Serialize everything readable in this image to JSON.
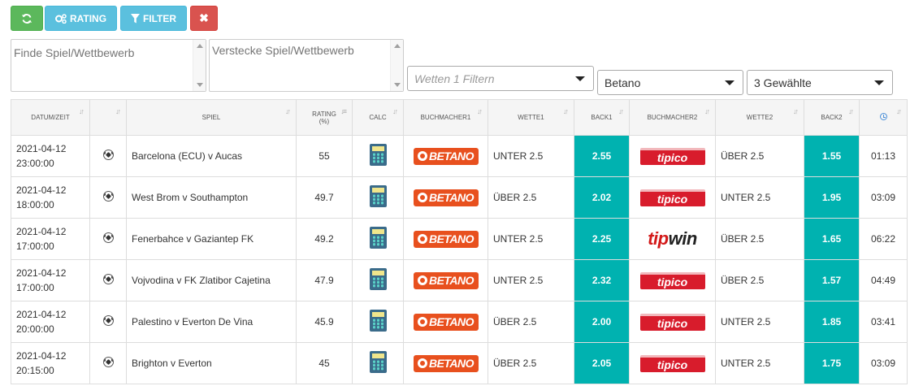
{
  "toolbar": {
    "refresh_icon": "refresh-icon",
    "rating_label": "RATING",
    "filter_label": "FILTER",
    "close_label": "✖"
  },
  "filters": {
    "find_placeholder": "Finde Spiel/Wettbewerb",
    "hide_placeholder": "Verstecke Spiel/Wettbewerb",
    "wetten_placeholder": "Wetten 1 Filtern",
    "bookmaker_selected": "Betano",
    "multi_selected": "3 Gewählte"
  },
  "table": {
    "headers": {
      "datum": "DATUM/ZEIT",
      "spiel": "SPIEL",
      "rating": "RATING",
      "rating_unit": "(%)",
      "calc": "CALC",
      "buch1": "BUCHMACHER1",
      "wette1": "WETTE1",
      "back1": "BACK1",
      "buch2": "BUCHMACHER2",
      "wette2": "WETTE2",
      "back2": "BACK2"
    },
    "rows": [
      {
        "date": "2021-04-12",
        "time": "23:00:00",
        "game": "Barcelona (ECU) v Aucas",
        "rating": "55",
        "bookmaker1": "BETANO",
        "bet1": "UNTER 2.5",
        "back1": "2.55",
        "bookmaker2": "tipico",
        "bet2": "ÜBER 2.5",
        "back2": "1.55",
        "elapsed": "01:13"
      },
      {
        "date": "2021-04-12",
        "time": "18:00:00",
        "game": "West Brom v Southampton",
        "rating": "49.7",
        "bookmaker1": "BETANO",
        "bet1": "ÜBER 2.5",
        "back1": "2.02",
        "bookmaker2": "tipico",
        "bet2": "UNTER 2.5",
        "back2": "1.95",
        "elapsed": "03:09"
      },
      {
        "date": "2021-04-12",
        "time": "17:00:00",
        "game": "Fenerbahce v Gaziantep FK",
        "rating": "49.2",
        "bookmaker1": "BETANO",
        "bet1": "UNTER 2.5",
        "back1": "2.25",
        "bookmaker2": "tipwin",
        "bet2": "ÜBER 2.5",
        "back2": "1.65",
        "elapsed": "06:22"
      },
      {
        "date": "2021-04-12",
        "time": "17:00:00",
        "game": "Vojvodina v FK Zlatibor Cajetina",
        "rating": "47.9",
        "bookmaker1": "BETANO",
        "bet1": "UNTER 2.5",
        "back1": "2.32",
        "bookmaker2": "tipico",
        "bet2": "ÜBER 2.5",
        "back2": "1.57",
        "elapsed": "04:49"
      },
      {
        "date": "2021-04-12",
        "time": "20:00:00",
        "game": "Palestino v Everton De Vina",
        "rating": "45.9",
        "bookmaker1": "BETANO",
        "bet1": "ÜBER 2.5",
        "back1": "2.00",
        "bookmaker2": "tipico",
        "bet2": "UNTER 2.5",
        "back2": "1.85",
        "elapsed": "03:41"
      },
      {
        "date": "2021-04-12",
        "time": "20:15:00",
        "game": "Brighton v Everton",
        "rating": "45",
        "bookmaker1": "BETANO",
        "bet1": "ÜBER 2.5",
        "back1": "2.05",
        "bookmaker2": "tipico",
        "bet2": "UNTER 2.5",
        "back2": "1.75",
        "elapsed": "03:09"
      }
    ]
  },
  "colors": {
    "back_cell": "#00b2b0",
    "betano": "#e8501e",
    "tipico": "#d81c2c",
    "tipwin_red": "#d31a1a"
  }
}
